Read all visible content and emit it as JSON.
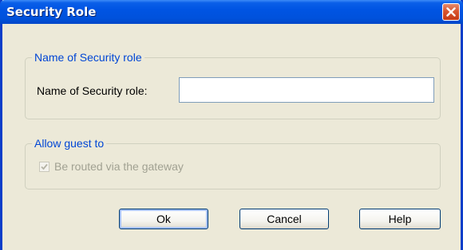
{
  "window": {
    "title": "Security Role",
    "close_icon": "close-icon"
  },
  "name_group": {
    "legend": "Name of Security role",
    "field_label": "Name of Security role:",
    "field_value": "",
    "field_placeholder": ""
  },
  "guest_group": {
    "legend": "Allow guest to",
    "checkbox_label": "Be routed via the gateway",
    "checkbox_checked": true,
    "checkbox_disabled": true
  },
  "buttons": {
    "ok": "Ok",
    "cancel": "Cancel",
    "help": "Help"
  },
  "colors": {
    "titlebar": "#0054e3",
    "legend_text": "#0046d5",
    "disabled_text": "#a1a192",
    "dialog_bg": "#ece9d8"
  }
}
